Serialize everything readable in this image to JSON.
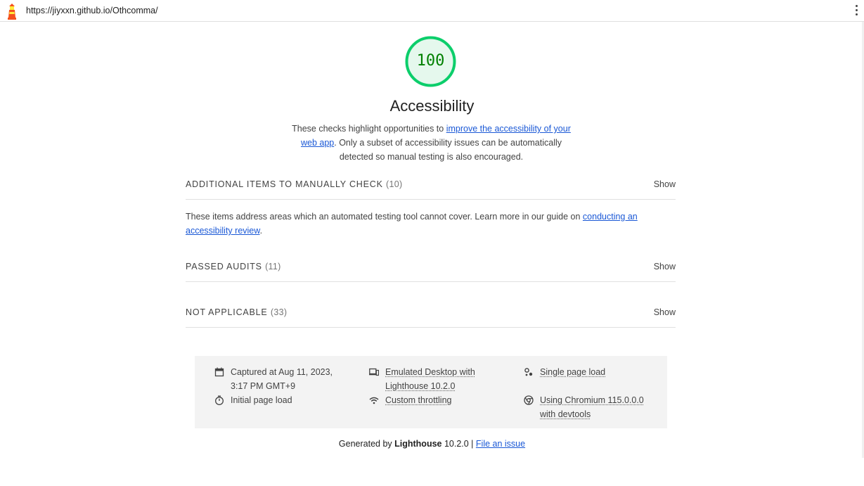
{
  "topbar": {
    "url": "https://jiyxxn.github.io/Othcomma/"
  },
  "score": {
    "value": "100",
    "color": "#0cce6b",
    "text_color": "#008000"
  },
  "category": {
    "title": "Accessibility",
    "desc_before": "These checks highlight opportunities to ",
    "desc_link": "improve the accessibility of your web app",
    "desc_after": ". Only a subset of accessibility issues can be automatically detected so manual testing is also encouraged."
  },
  "groups": [
    {
      "title": "ADDITIONAL ITEMS TO MANUALLY CHECK",
      "count": "(10)",
      "toggle": "Show"
    },
    {
      "title": "PASSED AUDITS",
      "count": "(11)",
      "toggle": "Show"
    },
    {
      "title": "NOT APPLICABLE",
      "count": "(33)",
      "toggle": "Show"
    }
  ],
  "manual_desc": {
    "before": "These items address areas which an automated testing tool cannot cover. Learn more in our guide on ",
    "link": "conducting an accessibility review",
    "after": "."
  },
  "meta": {
    "captured_line1": "Captured at Aug 11, 2023,",
    "captured_line2": "3:17 PM GMT+9",
    "initial_load": "Initial page load",
    "emulated_line1": "Emulated Desktop with",
    "emulated_line2": "Lighthouse 10.2.0",
    "throttling": "Custom throttling",
    "single_load": "Single page load",
    "chromium_line1": "Using Chromium 115.0.0.0",
    "chromium_line2": "with devtools"
  },
  "footer": {
    "generated_by": "Generated by ",
    "product": "Lighthouse",
    "version": " 10.2.0 | ",
    "issue_link": "File an issue"
  }
}
